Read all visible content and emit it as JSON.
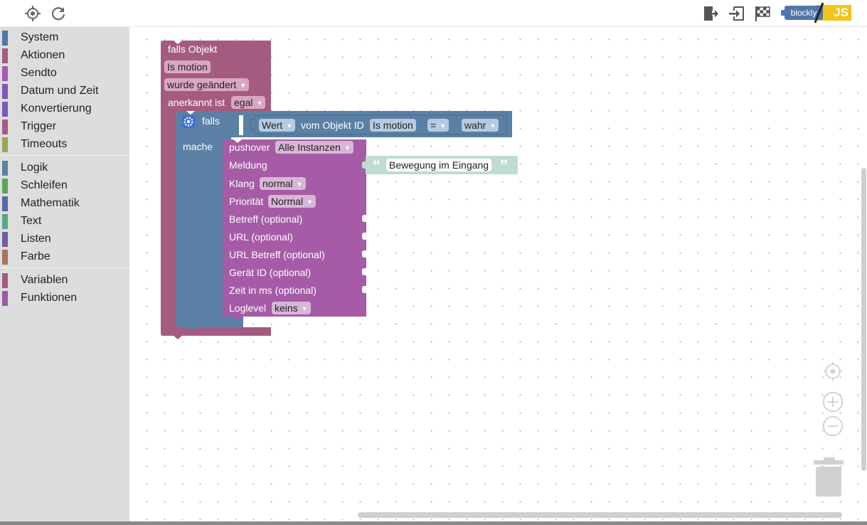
{
  "toolbar": {
    "icons": [
      "locate-icon",
      "refresh-icon",
      "export-icon",
      "import-icon",
      "checkered-flag-icon"
    ],
    "logo_text": "blockly",
    "logo_js": "JS",
    "colors": {
      "blockly": "#4f76a8",
      "js": "#f2c418"
    }
  },
  "sidebar": {
    "groups": [
      [
        {
          "label": "System",
          "color": "#4f76a8"
        },
        {
          "label": "Aktionen",
          "color": "#a55a81"
        },
        {
          "label": "Sendto",
          "color": "#a55ab4"
        },
        {
          "label": "Datum und Zeit",
          "color": "#7a5ab4"
        },
        {
          "label": "Konvertierung",
          "color": "#7a5ab4"
        },
        {
          "label": "Trigger",
          "color": "#a55a81"
        },
        {
          "label": "Timeouts",
          "color": "#9aa55a"
        }
      ],
      [
        {
          "label": "Logik",
          "color": "#5b80a5"
        },
        {
          "label": "Schleifen",
          "color": "#5ba55b"
        },
        {
          "label": "Mathematik",
          "color": "#5b67a5"
        },
        {
          "label": "Text",
          "color": "#5ba58c"
        },
        {
          "label": "Listen",
          "color": "#745ba5"
        },
        {
          "label": "Farbe",
          "color": "#a5745b"
        }
      ],
      [
        {
          "label": "Variablen",
          "color": "#a55b80"
        },
        {
          "label": "Funktionen",
          "color": "#995ba5"
        }
      ]
    ]
  },
  "blocks": {
    "trigger": {
      "title": "falls Objekt",
      "object_id": "Is motion",
      "condition": "wurde geändert",
      "ack_label": "anerkannt ist",
      "ack_value": "egal",
      "color": "#a55b80"
    },
    "if_block": {
      "falls_label": "falls",
      "mache_label": "mache",
      "color": "#5b80a5"
    },
    "compare": {
      "property": "Wert",
      "of_label": "vom Objekt ID",
      "object_id": "Is motion",
      "operator": "=",
      "value": "wahr"
    },
    "pushover": {
      "title": "pushover",
      "instance": "Alle Instanzen",
      "color": "#a55ba5",
      "rows": [
        {
          "label": "Meldung"
        },
        {
          "label": "Klang",
          "value": "normal"
        },
        {
          "label": "Priorität",
          "value": "Normal"
        },
        {
          "label": "Betreff (optional)"
        },
        {
          "label": "URL (optional)"
        },
        {
          "label": "URL Betreff (optional)"
        },
        {
          "label": "Gerät ID (optional)"
        },
        {
          "label": "Zeit in ms (optional)"
        },
        {
          "label": "Loglevel",
          "value": "keins"
        }
      ]
    },
    "message": {
      "text": "Bewegung im Eingang",
      "color": "#bfdcd2"
    }
  },
  "workspace": {
    "controls": [
      "center-icon",
      "zoom-in-icon",
      "zoom-out-icon",
      "trash-icon"
    ]
  }
}
